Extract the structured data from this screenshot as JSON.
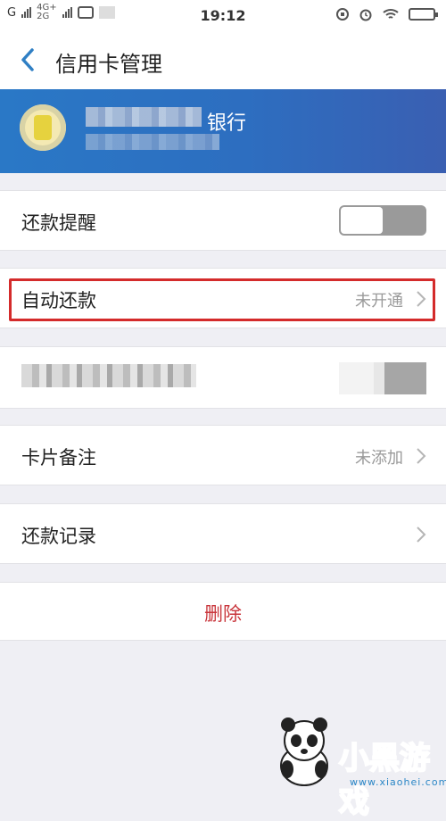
{
  "status_bar": {
    "carrier": "G",
    "network_top": "4G+",
    "network_bottom": "2G",
    "time": "19:12"
  },
  "header": {
    "title": "信用卡管理"
  },
  "banner": {
    "bank_suffix": "银行"
  },
  "rows": {
    "reminder": {
      "label": "还款提醒",
      "toggle_on": false
    },
    "auto_pay": {
      "label": "自动还款",
      "value": "未开通"
    },
    "card_note": {
      "label": "卡片备注",
      "value": "未添加"
    },
    "records": {
      "label": "还款记录"
    }
  },
  "delete": {
    "label": "删除"
  },
  "watermark": {
    "text": "小黑游戏",
    "url": "www.xiaohei.com"
  }
}
